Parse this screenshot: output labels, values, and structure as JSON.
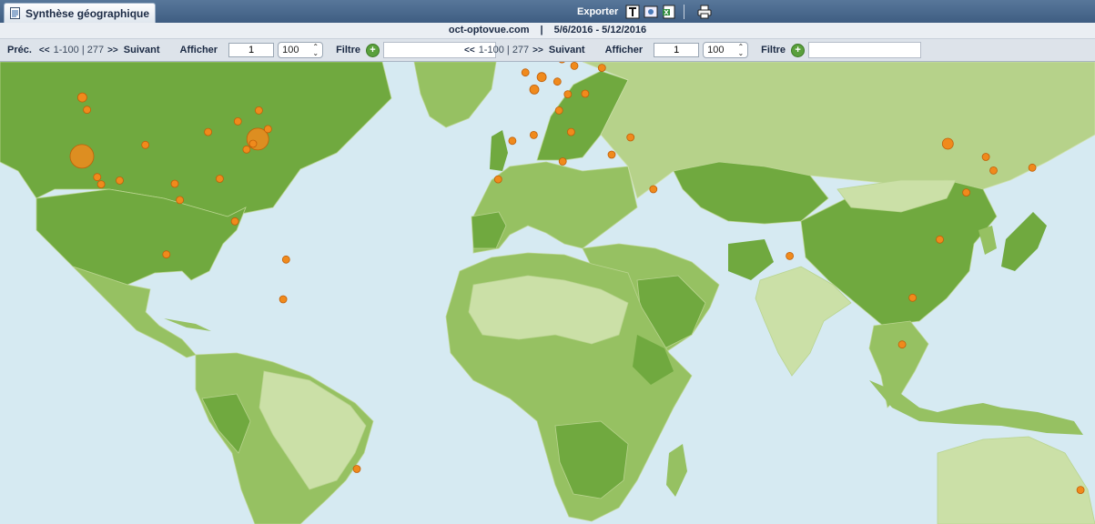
{
  "tab": {
    "title": "Synthèse géographique",
    "icon": "report-icon"
  },
  "toolbar": {
    "export_label": "Exporter",
    "icons": [
      "text-export-icon",
      "image-export-icon",
      "excel-export-icon",
      "print-icon"
    ]
  },
  "subtitle": {
    "site": "oct-optovue.com",
    "separator": "|",
    "date_range": "5/6/2016 - 5/12/2016"
  },
  "pager_left": {
    "prev_label": "Préc.",
    "range": "1-100",
    "divider": "|",
    "total": "277",
    "next_label": "Suivant",
    "show_label": "Afficher",
    "page_value": "1",
    "page_size": "100",
    "filter_label": "Filtre",
    "filter_value": ""
  },
  "pager_right": {
    "range": "1-100",
    "divider": "|",
    "total": "277",
    "next_label": "Suivant",
    "show_label": "Afficher",
    "page_value": "1",
    "page_size": "100",
    "filter_label": "Filtre",
    "filter_value": ""
  },
  "colors": {
    "ocean": "#d6eaf2",
    "land_dark": "#70a93f",
    "land_mid": "#96c162",
    "land_light": "#cbe0a7",
    "marker": "#f08a1c",
    "header": "#4a6a8f"
  },
  "markers": [
    {
      "lon": -122.4,
      "lat": 37.7,
      "r": 13
    },
    {
      "lon": -73.9,
      "lat": 40.7,
      "r": 12
    },
    {
      "lon": -122.3,
      "lat": 47.6,
      "r": 5
    },
    {
      "lon": -121.0,
      "lat": 45.6,
      "r": 4
    },
    {
      "lon": -118.2,
      "lat": 34.0,
      "r": 4
    },
    {
      "lon": -117.1,
      "lat": 32.7,
      "r": 4
    },
    {
      "lon": -112.0,
      "lat": 33.4,
      "r": 4
    },
    {
      "lon": -104.9,
      "lat": 39.7,
      "r": 4
    },
    {
      "lon": -96.8,
      "lat": 32.8,
      "r": 4
    },
    {
      "lon": -95.4,
      "lat": 29.8,
      "r": 4
    },
    {
      "lon": -87.6,
      "lat": 41.9,
      "r": 4
    },
    {
      "lon": -84.4,
      "lat": 33.7,
      "r": 4
    },
    {
      "lon": -80.2,
      "lat": 25.8,
      "r": 4
    },
    {
      "lon": -77.0,
      "lat": 38.9,
      "r": 4
    },
    {
      "lon": -75.2,
      "lat": 39.9,
      "r": 4
    },
    {
      "lon": -71.1,
      "lat": 42.4,
      "r": 4
    },
    {
      "lon": -79.4,
      "lat": 43.7,
      "r": 4
    },
    {
      "lon": -73.6,
      "lat": 45.5,
      "r": 4
    },
    {
      "lon": -99.1,
      "lat": 19.4,
      "r": 4
    },
    {
      "lon": -66.1,
      "lat": 18.4,
      "r": 4
    },
    {
      "lon": -66.9,
      "lat": 10.5,
      "r": 4
    },
    {
      "lon": -46.6,
      "lat": -23.5,
      "r": 4
    },
    {
      "lon": -0.1,
      "lat": 51.5,
      "r": 4
    },
    {
      "lon": 2.35,
      "lat": 48.85,
      "r": 5
    },
    {
      "lon": 4.4,
      "lat": 50.8,
      "r": 5
    },
    {
      "lon": 8.7,
      "lat": 50.1,
      "r": 4
    },
    {
      "lon": 13.4,
      "lat": 52.5,
      "r": 4
    },
    {
      "lon": 10.0,
      "lat": 53.5,
      "r": 4
    },
    {
      "lon": 11.6,
      "lat": 48.1,
      "r": 4
    },
    {
      "lon": 12.5,
      "lat": 41.9,
      "r": 4
    },
    {
      "lon": 9.2,
      "lat": 45.5,
      "r": 4
    },
    {
      "lon": -3.7,
      "lat": 40.4,
      "r": 4
    },
    {
      "lon": 2.2,
      "lat": 41.4,
      "r": 4
    },
    {
      "lon": 16.4,
      "lat": 48.2,
      "r": 4
    },
    {
      "lon": 21.0,
      "lat": 52.2,
      "r": 4
    },
    {
      "lon": 18.1,
      "lat": 59.3,
      "r": 4
    },
    {
      "lon": 10.8,
      "lat": 59.9,
      "r": 4
    },
    {
      "lon": 24.9,
      "lat": 60.2,
      "r": 4
    },
    {
      "lon": 37.6,
      "lat": 55.8,
      "r": 4
    },
    {
      "lon": 49.1,
      "lat": 55.8,
      "r": 4
    },
    {
      "lon": 23.7,
      "lat": 38.0,
      "r": 4
    },
    {
      "lon": 28.9,
      "lat": 41.0,
      "r": 4
    },
    {
      "lon": 35.2,
      "lat": 31.8,
      "r": 4
    },
    {
      "lon": -7.6,
      "lat": 33.6,
      "r": 4
    },
    {
      "lon": 10.2,
      "lat": 36.8,
      "r": 4
    },
    {
      "lon": 72.8,
      "lat": 19.1,
      "r": 4
    },
    {
      "lon": 116.4,
      "lat": 39.9,
      "r": 6
    },
    {
      "lon": 121.5,
      "lat": 31.2,
      "r": 4
    },
    {
      "lon": 114.2,
      "lat": 22.3,
      "r": 4
    },
    {
      "lon": 106.7,
      "lat": 10.8,
      "r": 4
    },
    {
      "lon": 103.8,
      "lat": 1.35,
      "r": 4
    },
    {
      "lon": 126.9,
      "lat": 37.6,
      "r": 4
    },
    {
      "lon": 129.0,
      "lat": 35.2,
      "r": 4
    },
    {
      "lon": 139.7,
      "lat": 35.7,
      "r": 4
    },
    {
      "lon": 153.0,
      "lat": -27.5,
      "r": 4
    }
  ]
}
